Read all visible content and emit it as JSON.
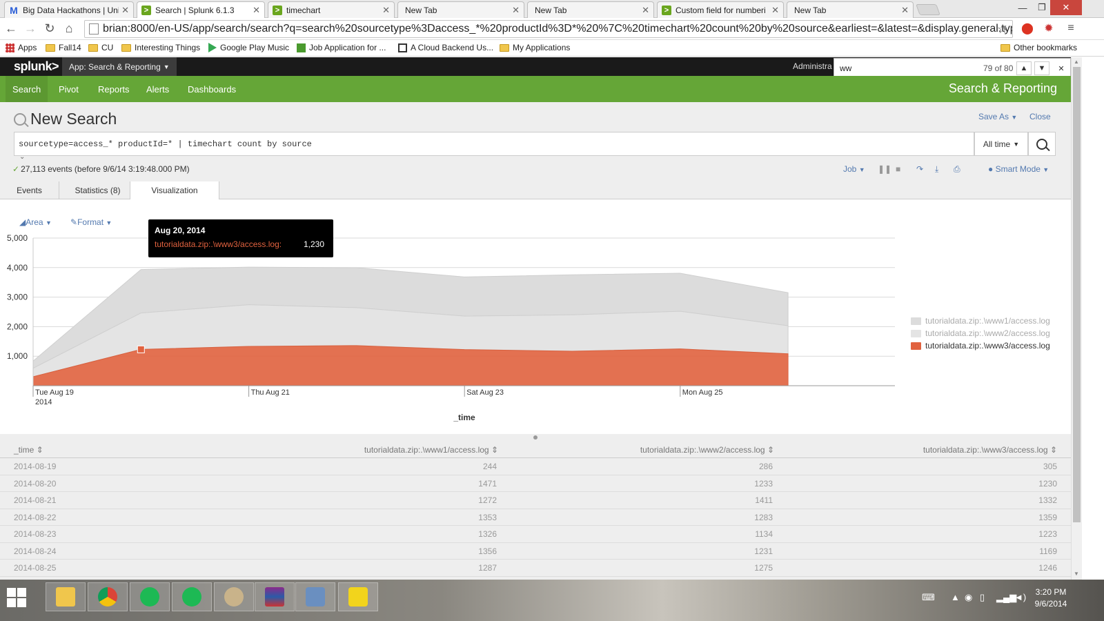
{
  "browser": {
    "tabs": [
      {
        "title": "Big Data Hackathons | Uni",
        "icon": "gmail-icon"
      },
      {
        "title": "Search | Splunk 6.1.3",
        "icon": "splunk-icon",
        "active": true
      },
      {
        "title": "timechart",
        "icon": "splunk-icon"
      },
      {
        "title": "New Tab",
        "icon": "blank"
      },
      {
        "title": "New Tab",
        "icon": "blank"
      },
      {
        "title": "Custom field for numberi",
        "icon": "splunk-icon"
      },
      {
        "title": "New Tab",
        "icon": "blank"
      }
    ],
    "url": "brian:8000/en-US/app/search/search?q=search%20sourcetype%3Daccess_*%20productId%3D*%20%7C%20timechart%20count%20by%20source&earliest=&latest=&display.general.typ",
    "bookmarks": [
      "Apps",
      "Fall14",
      "CU",
      "Interesting Things",
      "Google Play Music",
      "Job Application for ...",
      "A Cloud Backend Us...",
      "My Applications"
    ],
    "other_bookmarks": "Other bookmarks"
  },
  "find_bar": {
    "query": "ww",
    "count": "79 of 80"
  },
  "splunk": {
    "logo": "splunk>",
    "app_menu": "App: Search & Reporting",
    "user": "Administra",
    "nav": [
      "Search",
      "Pivot",
      "Reports",
      "Alerts",
      "Dashboards"
    ],
    "app_title": "Search & Reporting",
    "page_title": "New Search",
    "save_as": "Save As",
    "close": "Close",
    "query": "sourcetype=access_* productId=* | timechart count by source",
    "time_range": "All time",
    "events_status": "27,113 events (before 9/6/14 3:19:48.000 PM)",
    "job": "Job",
    "smart_mode": "Smart Mode",
    "tabs": [
      "Events",
      "Statistics (8)",
      "Visualization"
    ],
    "viz_type": "Area",
    "format": "Format"
  },
  "chart_data": {
    "type": "area",
    "stacked": true,
    "xlabel": "_time",
    "x_tick_labels": [
      {
        "label": "Tue Aug 19",
        "sub": "2014"
      },
      {
        "label": "Thu Aug 21",
        "sub": ""
      },
      {
        "label": "Sat Aug 23",
        "sub": ""
      },
      {
        "label": "Mon Aug 25",
        "sub": ""
      }
    ],
    "y_ticks": [
      "5,000",
      "4,000",
      "3,000",
      "2,000",
      "1,000"
    ],
    "ylim": [
      0,
      5000
    ],
    "x": [
      "2014-08-19",
      "2014-08-20",
      "2014-08-21",
      "2014-08-22",
      "2014-08-23",
      "2014-08-24",
      "2014-08-25",
      "2014-08-26"
    ],
    "series": [
      {
        "name": "tutorialdata.zip:.\\www1/access.log",
        "color": "#dcdcdc",
        "values": [
          244,
          1471,
          1272,
          1353,
          1326,
          1356,
          1287,
          1120
        ]
      },
      {
        "name": "tutorialdata.zip:.\\www2/access.log",
        "color": "#e4e4e4",
        "values": [
          286,
          1233,
          1411,
          1283,
          1134,
          1231,
          1275,
          950
        ]
      },
      {
        "name": "tutorialdata.zip:.\\www3/access.log",
        "color": "#e1623f",
        "values": [
          305,
          1230,
          1332,
          1359,
          1223,
          1169,
          1246,
          1080
        ]
      }
    ],
    "legend_position": "right",
    "tooltip": {
      "date": "Aug 20, 2014",
      "series": "tutorialdata.zip:.\\www3/access.log:",
      "value": "1,230"
    }
  },
  "table": {
    "headers": [
      "_time",
      "tutorialdata.zip:.\\www1/access.log",
      "tutorialdata.zip:.\\www2/access.log",
      "tutorialdata.zip:.\\www3/access.log"
    ],
    "rows": [
      [
        "2014-08-19",
        "244",
        "286",
        "305"
      ],
      [
        "2014-08-20",
        "1471",
        "1233",
        "1230"
      ],
      [
        "2014-08-21",
        "1272",
        "1411",
        "1332"
      ],
      [
        "2014-08-22",
        "1353",
        "1283",
        "1359"
      ],
      [
        "2014-08-23",
        "1326",
        "1134",
        "1223"
      ],
      [
        "2014-08-24",
        "1356",
        "1231",
        "1169"
      ],
      [
        "2014-08-25",
        "1287",
        "1275",
        "1246"
      ]
    ]
  },
  "taskbar": {
    "apps": [
      "file-explorer-icon",
      "chrome-icon",
      "spotify-icon",
      "spotify-icon",
      "paint-icon",
      "winrar-icon",
      "virtualbox-icon",
      "idea-icon"
    ],
    "time": "3:20 PM",
    "date": "9/6/2014"
  }
}
